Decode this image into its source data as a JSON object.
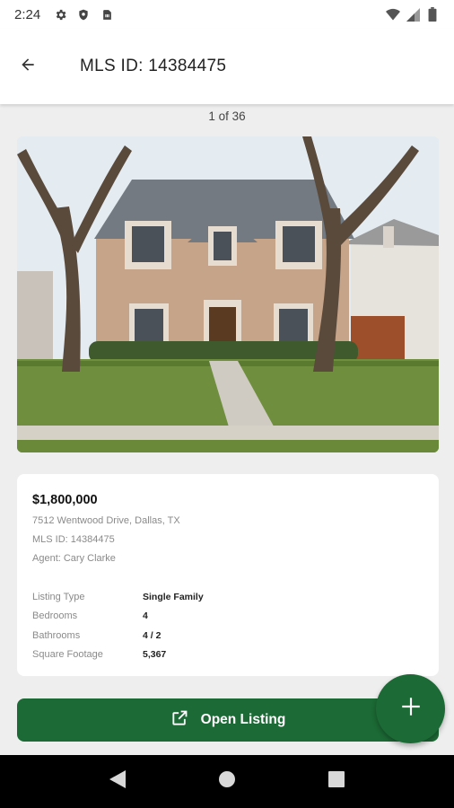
{
  "status_bar": {
    "time": "2:24",
    "left_icons": [
      "gear-icon",
      "shield-icon",
      "sim-card-icon"
    ],
    "right_icons": [
      "wifi-icon",
      "signal-icon",
      "battery-icon"
    ]
  },
  "header": {
    "title": "MLS ID: 14384475",
    "back_icon": "arrow-back-icon"
  },
  "gallery": {
    "counter": "1 of 36"
  },
  "listing": {
    "price": "$1,800,000",
    "address": "7512 Wentwood Drive, Dallas, TX",
    "mls": "MLS ID: 14384475",
    "agent": "Agent: Cary Clarke",
    "facts": [
      {
        "label": "Listing Type",
        "value": "Single Family"
      },
      {
        "label": "Bedrooms",
        "value": "4"
      },
      {
        "label": "Bathrooms",
        "value": "4 / 2"
      },
      {
        "label": "Square Footage",
        "value": "5,367"
      }
    ]
  },
  "actions": {
    "open_listing": "Open Listing",
    "open_icon": "external-link-icon",
    "fab_icon": "plus-icon"
  },
  "colors": {
    "brand_green": "#1c6a35",
    "background": "#eeeeee"
  },
  "nav_bar": {
    "icons": [
      "back-triangle-icon",
      "home-circle-icon",
      "recents-square-icon"
    ]
  }
}
